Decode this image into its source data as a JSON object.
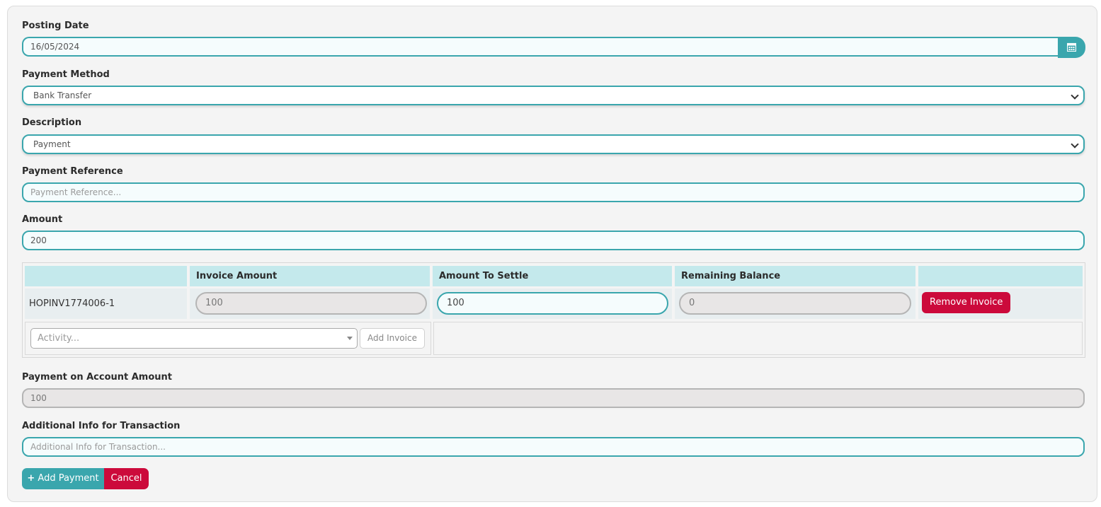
{
  "form": {
    "posting_date": {
      "label": "Posting Date",
      "value": "16/05/2024"
    },
    "payment_method": {
      "label": "Payment Method",
      "value": "Bank Transfer"
    },
    "description": {
      "label": "Description",
      "value": "Payment"
    },
    "payment_reference": {
      "label": "Payment Reference",
      "placeholder": "Payment Reference..."
    },
    "amount": {
      "label": "Amount",
      "value": "200"
    },
    "payment_on_account": {
      "label": "Payment on Account Amount",
      "value": "100"
    },
    "additional_info": {
      "label": "Additional Info for Transaction",
      "placeholder": "Additional Info for Transaction..."
    }
  },
  "invoice_table": {
    "headers": [
      "",
      "Invoice Amount",
      "Amount To Settle",
      "Remaining Balance",
      ""
    ],
    "rows": [
      {
        "invoice_id": "HOPINV1774006-1",
        "invoice_amount": "100",
        "amount_to_settle": "100",
        "remaining_balance": "0",
        "remove_label": "Remove Invoice"
      }
    ],
    "activity_placeholder": "Activity...",
    "add_invoice_label": "Add Invoice"
  },
  "actions": {
    "add_payment_label": "Add Payment",
    "add_payment_icon": "plus-icon",
    "cancel_label": "Cancel"
  },
  "icons": {
    "calendar": "calendar-icon"
  },
  "colors": {
    "accent": "#3aa6ad",
    "danger": "#cc0a3b",
    "header_bg": "#c4e9ec"
  }
}
